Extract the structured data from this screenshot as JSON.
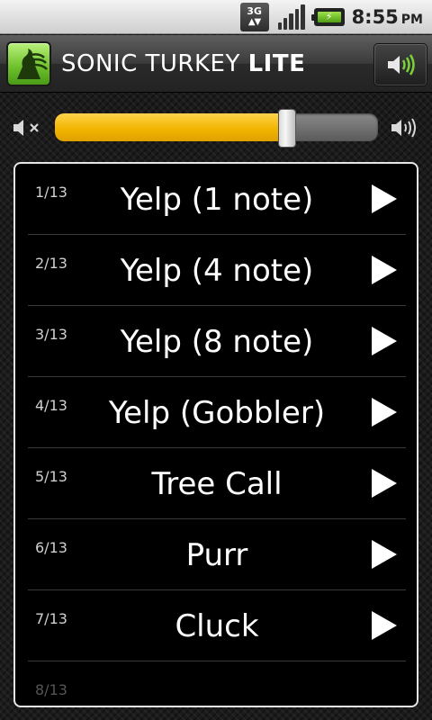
{
  "status_bar": {
    "network_label": "3G",
    "time": "8:55",
    "ampm": "PM",
    "icons": [
      "network-3g-icon",
      "signal-icon",
      "battery-charging-icon"
    ]
  },
  "app": {
    "title_main": "SONIC TURKEY",
    "title_suffix": "LITE",
    "logo_icon": "turkey-logo-icon",
    "sound_toggle_icon": "speaker-on-icon"
  },
  "volume": {
    "level": 0.72,
    "min_icon": "speaker-mute-icon",
    "max_icon": "speaker-loud-icon",
    "fill_color": "#f2b500"
  },
  "sounds": [
    {
      "index": "1/13",
      "name": "Yelp (1 note)"
    },
    {
      "index": "2/13",
      "name": "Yelp (4 note)"
    },
    {
      "index": "3/13",
      "name": "Yelp (8 note)"
    },
    {
      "index": "4/13",
      "name": "Yelp (Gobbler)"
    },
    {
      "index": "5/13",
      "name": "Tree Call"
    },
    {
      "index": "6/13",
      "name": "Purr"
    },
    {
      "index": "7/13",
      "name": "Cluck"
    },
    {
      "index": "8/13",
      "name": ""
    }
  ]
}
